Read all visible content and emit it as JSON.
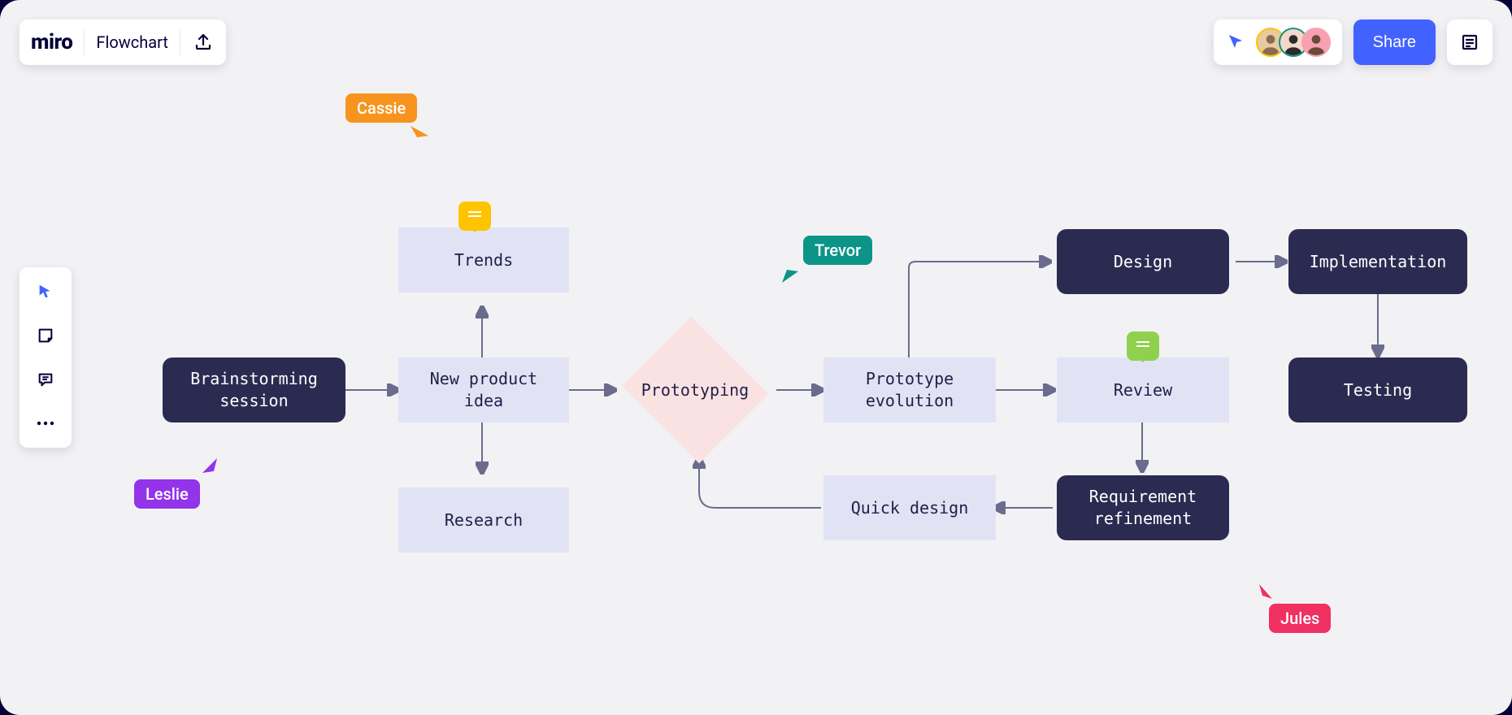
{
  "header": {
    "logo_text": "miro",
    "board_title": "Flowchart",
    "share_label": "Share"
  },
  "toolbar": {
    "tools": [
      "select",
      "sticky-note",
      "comment",
      "more"
    ]
  },
  "cursors": {
    "cassie": {
      "name": "Cassie",
      "color": "#F7941D"
    },
    "leslie": {
      "name": "Leslie",
      "color": "#9333EA"
    },
    "trevor": {
      "name": "Trevor",
      "color": "#0D9488"
    },
    "jules": {
      "name": "Jules",
      "color": "#EF3061"
    }
  },
  "nodes": {
    "brainstorm": {
      "label": "Brainstorming\nsession",
      "type": "dark"
    },
    "new_idea": {
      "label": "New product\nidea",
      "type": "light"
    },
    "trends": {
      "label": "Trends",
      "type": "light"
    },
    "research": {
      "label": "Research",
      "type": "light"
    },
    "prototyping": {
      "label": "Prototyping",
      "type": "diamond"
    },
    "evolution": {
      "label": "Prototype\nevolution",
      "type": "light"
    },
    "review": {
      "label": "Review",
      "type": "light"
    },
    "design": {
      "label": "Design",
      "type": "dark"
    },
    "impl": {
      "label": "Implementation",
      "type": "dark"
    },
    "testing": {
      "label": "Testing",
      "type": "dark"
    },
    "req": {
      "label": "Requirement\nrefinement",
      "type": "dark"
    },
    "quick": {
      "label": "Quick design",
      "type": "light"
    }
  },
  "avatars": [
    {
      "ring": "#FFC400",
      "bg": "#E8C9A0"
    },
    {
      "ring": "#0D9488",
      "bg": "#F3D9C9"
    },
    {
      "ring": "#F7A1B0",
      "bg": "#6B4A3A"
    }
  ]
}
